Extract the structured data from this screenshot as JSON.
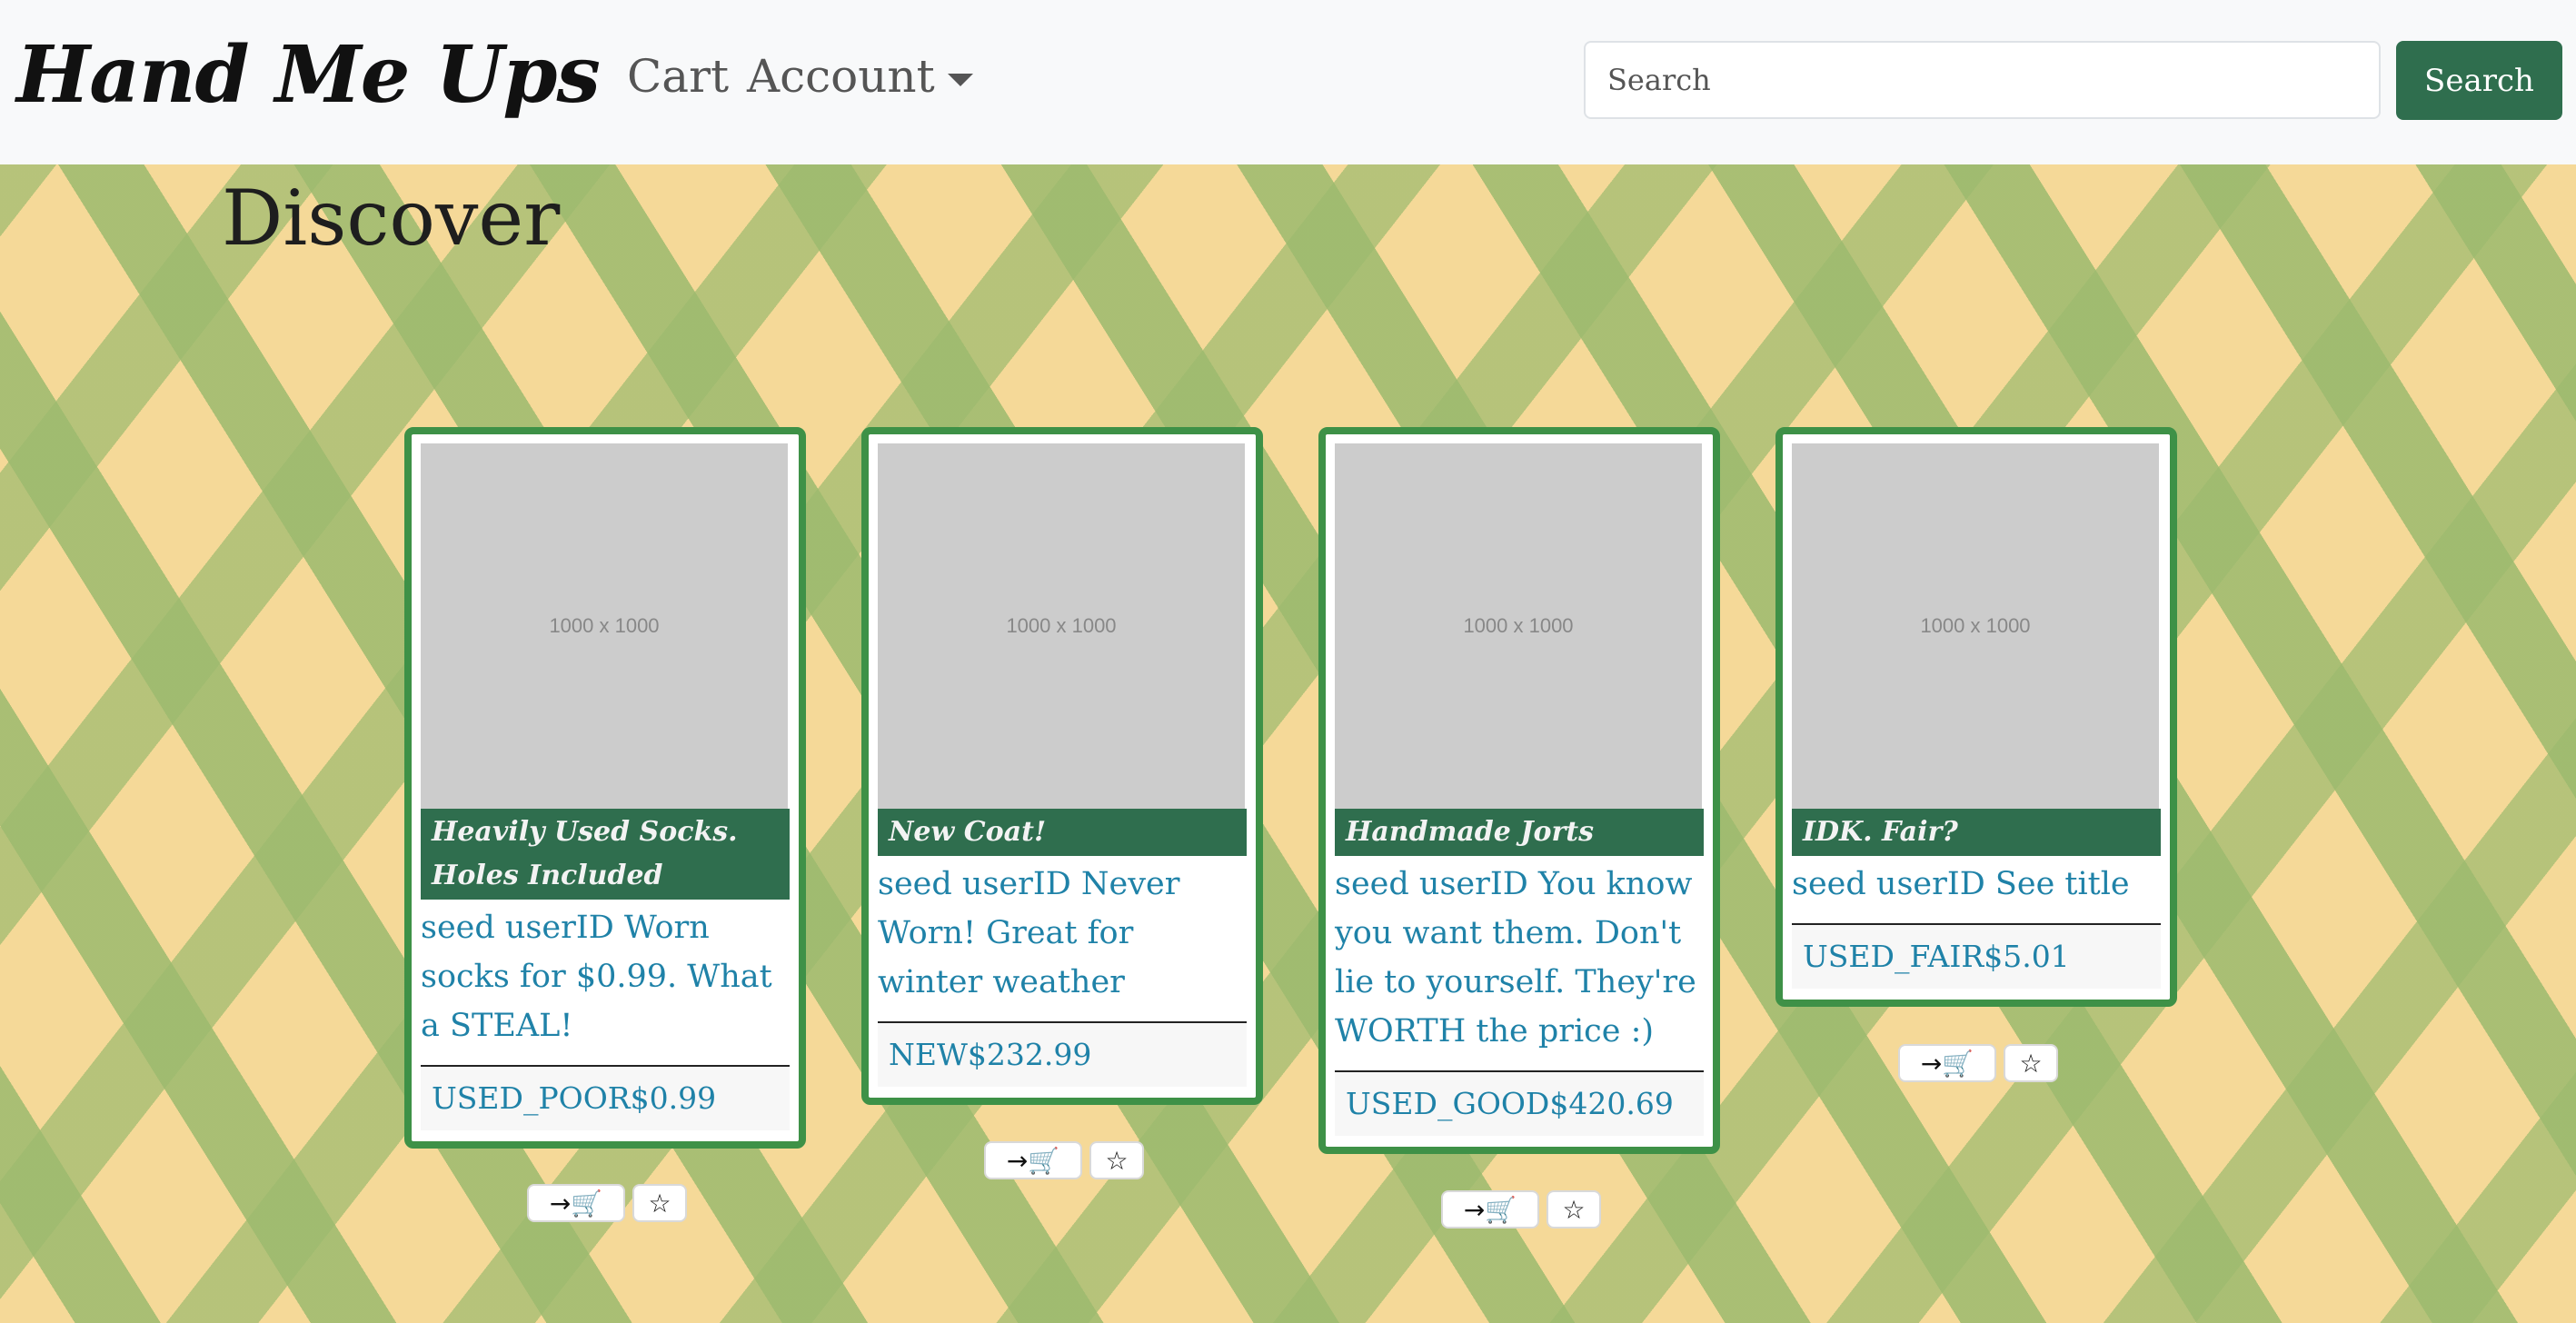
{
  "nav": {
    "brand": "Hand Me Ups",
    "cart_label": "Cart",
    "account_label": "Account",
    "search_placeholder": "Search",
    "search_button": "Search"
  },
  "page": {
    "title": "Discover"
  },
  "cards": [
    {
      "image_text": "1000 x 1000",
      "title": "Heavily Used Socks. Holes Included",
      "description": "seed userID Worn socks for $0.99. What a STEAL!",
      "footer": "USED_POOR$0.99",
      "cart_icon": "→🛒",
      "fav_icon": "☆"
    },
    {
      "image_text": "1000 x 1000",
      "title": "New Coat!",
      "description": "seed userID Never Worn! Great for winter weather",
      "footer": "NEW$232.99",
      "cart_icon": "→🛒",
      "fav_icon": "☆"
    },
    {
      "image_text": "1000 x 1000",
      "title": "Handmade Jorts",
      "description": "seed userID You know you want them. Don't lie to yourself. They're WORTH the price :)",
      "footer": "USED_GOOD$420.69",
      "cart_icon": "→🛒",
      "fav_icon": "☆"
    },
    {
      "image_text": "1000 x 1000",
      "title": "IDK. Fair?",
      "description": "seed userID See title",
      "footer": "USED_FAIR$5.01",
      "cart_icon": "→🛒",
      "fav_icon": "☆"
    }
  ],
  "colors": {
    "brand_green": "#2f6e4e",
    "card_border": "#3e9147",
    "link_blue": "#1f82a8",
    "background_yellow": "#f5d998",
    "background_green": "#9cba6e"
  }
}
